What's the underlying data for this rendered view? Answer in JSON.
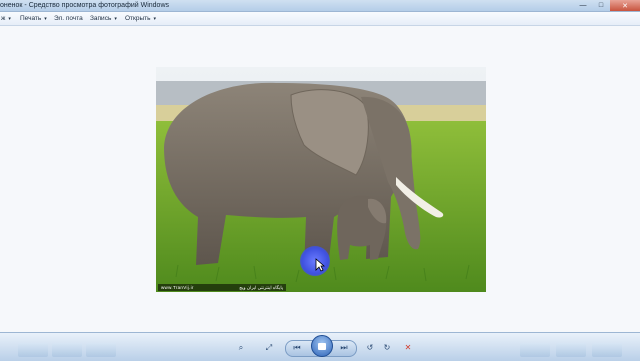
{
  "window": {
    "title": "оненок - Средство просмотра фотографий Windows",
    "controls": {
      "minimize": "—",
      "maximize": "□",
      "close": "✕"
    }
  },
  "menu": {
    "items": [
      {
        "label": "ж"
      },
      {
        "label": "Печать"
      },
      {
        "label": "Эл. почта"
      },
      {
        "label": "Запись"
      },
      {
        "label": "Открыть"
      }
    ],
    "arrow": "▾"
  },
  "photo": {
    "watermark_url": "www.TranVij.ir",
    "watermark_fa": "پایگاه اینترنتی ایران ویج"
  },
  "toolbar": {
    "zoom": "⌕",
    "fit": "⤢",
    "prev": "⏮",
    "next": "⏭",
    "rotate_ccw": "↺",
    "rotate_cw": "↻",
    "delete": "✕"
  },
  "colors": {
    "title_bar": "#b4cde8",
    "close": "#c8533e",
    "delete": "#d23b2b",
    "accent": "#2d63b8"
  }
}
